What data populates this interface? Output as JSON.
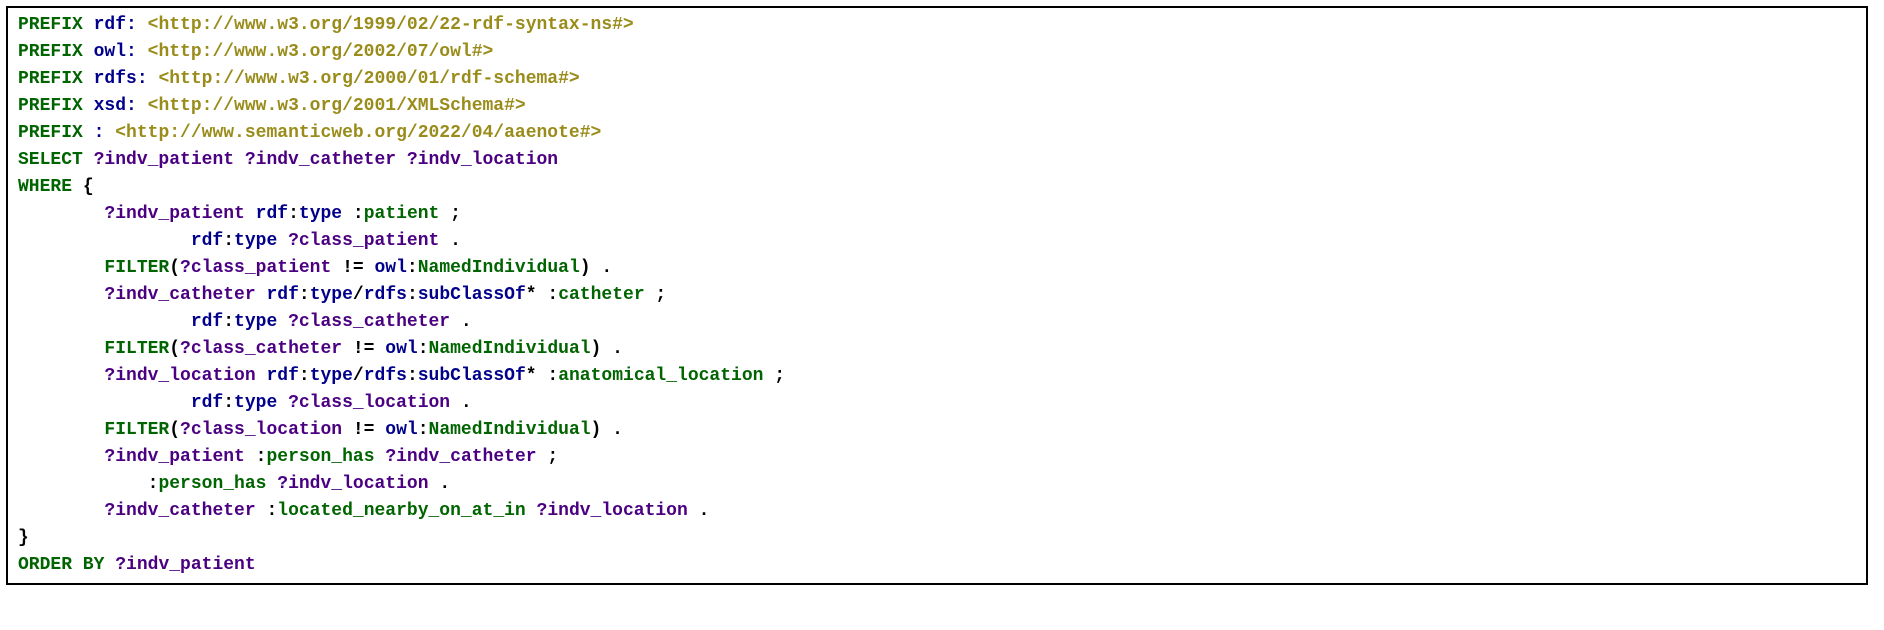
{
  "lines": {
    "l1_kw": "PREFIX ",
    "l1_pref": "rdf:",
    "l1_uri": " <http://www.w3.org/1999/02/22-rdf-syntax-ns#>",
    "l2_kw": "PREFIX ",
    "l2_pref": "owl:",
    "l2_uri": " <http://www.w3.org/2002/07/owl#>",
    "l3_kw": "PREFIX ",
    "l3_pref": "rdfs:",
    "l3_uri": " <http://www.w3.org/2000/01/rdf-schema#>",
    "l4_kw": "PREFIX ",
    "l4_pref": "xsd:",
    "l4_uri": " <http://www.w3.org/2001/XMLSchema#>",
    "l5_kw": "PREFIX ",
    "l5_pref": ":",
    "l5_uri": " <http://www.semanticweb.org/2022/04/aaenote#>",
    "l6_kw": "SELECT ",
    "l6_vars": "?indv_patient ?indv_catheter ?indv_location",
    "l7_kw": "WHERE",
    "l7_brace": " {",
    "l8_lead": "        ",
    "l8_v1": "?indv_patient",
    "l8_sp1": " ",
    "l8_p1": "rdf",
    "l8_colon1": ":",
    "l8_p2": "type",
    "l8_sp2": " ",
    "l8_colon2": ":",
    "l8_loc": "patient",
    "l8_end": " ;",
    "l9_lead": "                ",
    "l9_p1": "rdf",
    "l9_colon1": ":",
    "l9_p2": "type",
    "l9_sp": " ",
    "l9_var": "?class_patient",
    "l9_end": " .",
    "l10_lead": "        ",
    "l10_kw": "FILTER",
    "l10_open": "(",
    "l10_var": "?class_patient",
    "l10_ne": " != ",
    "l10_p1": "owl",
    "l10_colon": ":",
    "l10_loc": "NamedIndividual",
    "l10_close": ") .",
    "l11_lead": "        ",
    "l11_var": "?indv_catheter",
    "l11_sp": " ",
    "l11_p1": "rdf",
    "l11_c1": ":",
    "l11_p2": "type",
    "l11_slash": "/",
    "l11_p3": "rdfs",
    "l11_c2": ":",
    "l11_p4": "subClassOf",
    "l11_star": "* ",
    "l11_c3": ":",
    "l11_loc": "catheter",
    "l11_end": " ;",
    "l12_lead": "                ",
    "l12_p1": "rdf",
    "l12_c1": ":",
    "l12_p2": "type",
    "l12_sp": " ",
    "l12_var": "?class_catheter",
    "l12_end": " .",
    "l13_lead": "        ",
    "l13_kw": "FILTER",
    "l13_open": "(",
    "l13_var": "?class_catheter",
    "l13_ne": " != ",
    "l13_p1": "owl",
    "l13_c1": ":",
    "l13_loc": "NamedIndividual",
    "l13_close": ") .",
    "l14_lead": "        ",
    "l14_var": "?indv_location",
    "l14_sp": " ",
    "l14_p1": "rdf",
    "l14_c1": ":",
    "l14_p2": "type",
    "l14_slash": "/",
    "l14_p3": "rdfs",
    "l14_c2": ":",
    "l14_p4": "subClassOf",
    "l14_star": "* ",
    "l14_c3": ":",
    "l14_loc": "anatomical_location",
    "l14_end": " ;",
    "l15_lead": "                ",
    "l15_p1": "rdf",
    "l15_c1": ":",
    "l15_p2": "type",
    "l15_sp": " ",
    "l15_var": "?class_location",
    "l15_end": " .",
    "l16_lead": "        ",
    "l16_kw": "FILTER",
    "l16_open": "(",
    "l16_var": "?class_location",
    "l16_ne": " != ",
    "l16_p1": "owl",
    "l16_c1": ":",
    "l16_loc": "NamedIndividual",
    "l16_close": ") .",
    "l17_lead": "        ",
    "l17_var": "?indv_patient",
    "l17_sp": " ",
    "l17_c1": ":",
    "l17_loc": "person_has",
    "l17_sp2": " ",
    "l17_v2": "?indv_catheter",
    "l17_end": " ;",
    "l18_lead": "            ",
    "l18_c1": ":",
    "l18_loc": "person_has",
    "l18_sp": " ",
    "l18_var": "?indv_location",
    "l18_end": " .",
    "l19_lead": "        ",
    "l19_var": "?indv_catheter",
    "l19_sp": " ",
    "l19_c1": ":",
    "l19_loc": "located_nearby_on_at_in",
    "l19_sp2": " ",
    "l19_v2": "?indv_location",
    "l19_end": " .",
    "l20": "}",
    "l21_kw": "ORDER BY",
    "l21_sp": " ",
    "l21_var": "?indv_patient"
  }
}
